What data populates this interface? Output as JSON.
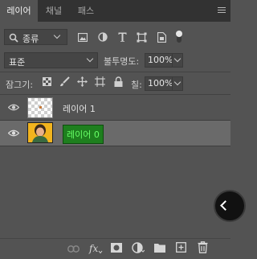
{
  "tabs": [
    {
      "label": "레이어",
      "active": true
    },
    {
      "label": "채널",
      "active": false
    },
    {
      "label": "패스",
      "active": false
    }
  ],
  "filter": {
    "kind_label": "종류",
    "icons": [
      "image-filter-icon",
      "adjustment-filter-icon",
      "type-filter-icon",
      "shape-filter-icon",
      "smart-object-filter-icon",
      "filter-toggle-icon"
    ]
  },
  "blend": {
    "mode": "표준",
    "opacity_label": "불투명도:",
    "opacity_value": "100%"
  },
  "lock": {
    "label": "잠그기:",
    "icons": [
      "lock-transparent-pixels-icon",
      "lock-image-pixels-icon",
      "lock-position-icon",
      "lock-artboard-icon",
      "lock-all-icon"
    ],
    "fill_label": "칠:",
    "fill_value": "100%"
  },
  "layers": [
    {
      "name": "레이어 1",
      "visible": true,
      "selected": false,
      "editing": false
    },
    {
      "name": "레이어 0",
      "visible": true,
      "selected": true,
      "editing": true
    }
  ],
  "bottom_icons": [
    "link-layers-icon",
    "layer-style-icon",
    "add-mask-icon",
    "adjustment-layer-icon",
    "new-group-icon",
    "new-layer-icon",
    "delete-layer-icon"
  ],
  "colors": {
    "panel_bg": "#535353",
    "tab_bar_bg": "#323232",
    "selected_row": "#6a6a6a",
    "edit_bg": "#1e7f1e",
    "edit_text": "#67ff67"
  }
}
